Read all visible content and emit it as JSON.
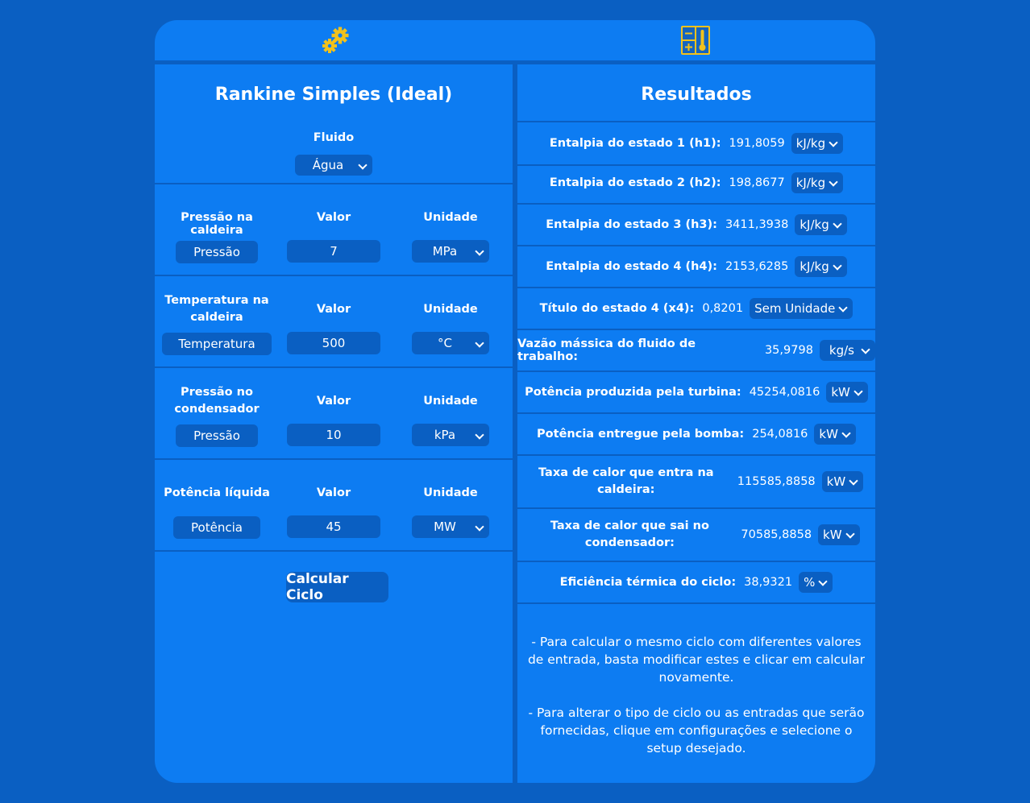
{
  "topbar": {
    "settings_icon": "gears-icon",
    "calculator_icon": "calculator-thermometer-icon"
  },
  "left": {
    "title": "Rankine Simples (Ideal)",
    "fluid_label": "Fluido",
    "fluid_value": "Água",
    "value_header": "Valor",
    "unit_header": "Unidade",
    "rows": [
      {
        "label": "Pressão na caldeira",
        "type": "Pressão",
        "value": "7",
        "unit": "MPa"
      },
      {
        "label": "Temperatura na caldeira",
        "type": "Temperatura",
        "value": "500",
        "unit": "°C"
      },
      {
        "label": "Pressão no condensador",
        "type": "Pressão",
        "value": "10",
        "unit": "kPa"
      },
      {
        "label": "Potência líquida",
        "type": "Potência",
        "value": "45",
        "unit": "MW"
      }
    ],
    "calculate_label": "Calcular Ciclo"
  },
  "right": {
    "title": "Resultados",
    "results": [
      {
        "label": "Entalpia do estado 1 (h1):",
        "value": "191,8059",
        "unit": "kJ/kg"
      },
      {
        "label": "Entalpia do estado 2 (h2):",
        "value": "198,8677",
        "unit": "kJ/kg"
      },
      {
        "label": "Entalpia do estado 3 (h3):",
        "value": "3411,3938",
        "unit": "kJ/kg"
      },
      {
        "label": "Entalpia do estado 4 (h4):",
        "value": "2153,6285",
        "unit": "kJ/kg"
      },
      {
        "label": "Título do estado 4 (x4):",
        "value": "0,8201",
        "unit": "Sem Unidade"
      },
      {
        "label": "Vazão mássica do fluido de trabalho:",
        "value": "35,9798",
        "unit": "kg/s"
      },
      {
        "label": "Potência produzida pela turbina:",
        "value": "45254,0816",
        "unit": "kW"
      },
      {
        "label": "Potência entregue pela bomba:",
        "value": "254,0816",
        "unit": "kW"
      },
      {
        "label": "Taxa de calor que entra na caldeira:",
        "value": "115585,8858",
        "unit": "kW"
      },
      {
        "label": "Taxa de calor que sai no condensador:",
        "value": "70585,8858",
        "unit": "kW"
      },
      {
        "label": "Eficiência térmica do ciclo:",
        "value": "38,9321",
        "unit": "%"
      }
    ],
    "note1": "- Para calcular o mesmo ciclo com diferentes valores de entrada, basta modificar estes e clicar em calcular novamente.",
    "note2": "- Para alterar o tipo de ciclo ou as entradas que serão fornecidas, clique em configurações e selecione o setup desejado."
  },
  "colors": {
    "background": "#0a5fc2",
    "panel": "#0d7cf2",
    "icon_yellow": "#f2c21b"
  }
}
